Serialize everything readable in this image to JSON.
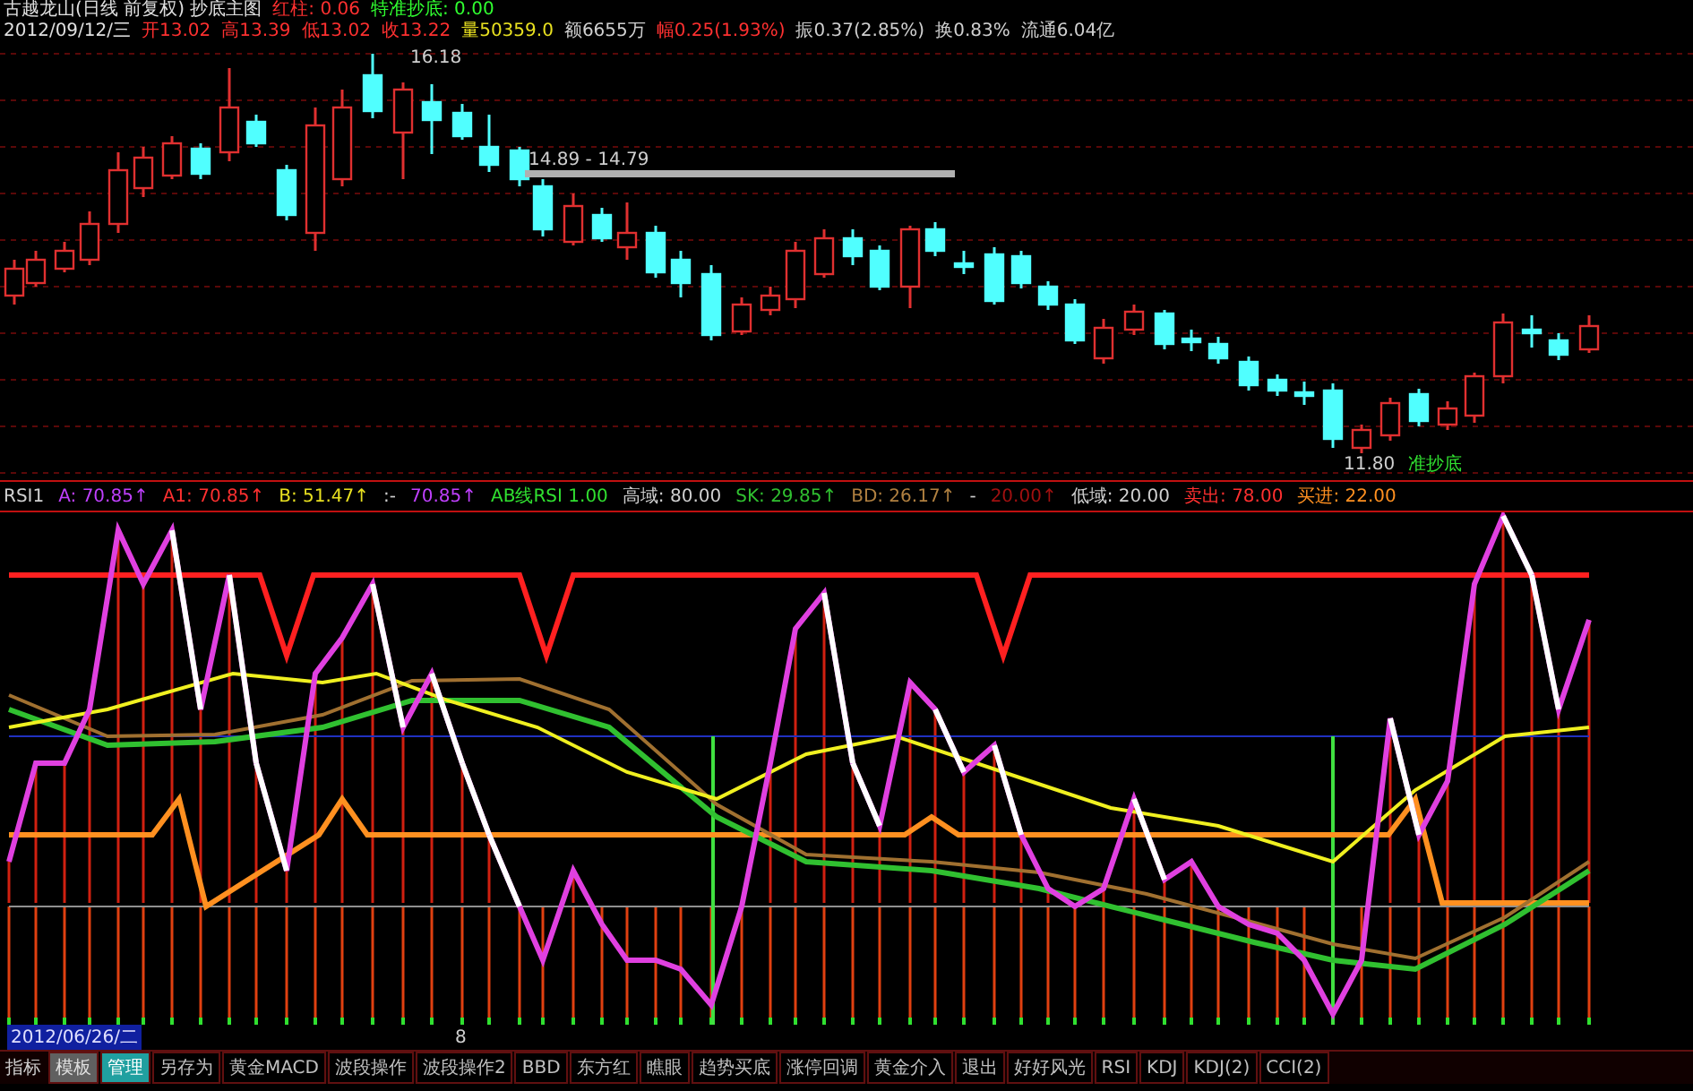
{
  "header": {
    "title": "古越龙山(日线 前复权) 抄底主图",
    "indicators": [
      {
        "label": "红柱:",
        "value": "0.06",
        "color": "#ff3030"
      },
      {
        "label": "特准抄底:",
        "value": "0.00",
        "color": "#30ff30"
      }
    ]
  },
  "quote": {
    "date": "2012/09/12/三",
    "fields": [
      {
        "label": "开",
        "value": "13.02",
        "color": "#ff3030"
      },
      {
        "label": "高",
        "value": "13.39",
        "color": "#ff3030"
      },
      {
        "label": "低",
        "value": "13.02",
        "color": "#ff3030"
      },
      {
        "label": "收",
        "value": "13.22",
        "color": "#ff3030"
      },
      {
        "label": "量",
        "value": "50359.0",
        "color": "#e8e020"
      },
      {
        "label": "额",
        "value": "6655万",
        "color": "#d0d0d0"
      },
      {
        "label": "幅",
        "value": "0.25(1.93%)",
        "color": "#ff3030"
      },
      {
        "label": "振",
        "value": "0.37(2.85%)",
        "color": "#d0d0d0"
      },
      {
        "label": "换",
        "value": "0.83%",
        "color": "#d0d0d0"
      },
      {
        "label": "流通",
        "value": "6.04亿",
        "color": "#d0d0d0"
      }
    ]
  },
  "price_labels": {
    "high": "16.18",
    "range": "14.89 - 14.79",
    "low": "11.80",
    "low_note": "准抄底"
  },
  "rsi_header": [
    {
      "text": "RSI1",
      "color": "#d0d0d0"
    },
    {
      "text": "A: 70.85↑",
      "color": "#c040ff"
    },
    {
      "text": "A1: 70.85↑",
      "color": "#ff3030"
    },
    {
      "text": "B: 51.47↑",
      "color": "#e8e020"
    },
    {
      "text": ":-",
      "color": "#d0d0d0"
    },
    {
      "text": "70.85↑",
      "color": "#c040ff"
    },
    {
      "text": "AB线RSI 1.00",
      "color": "#30e030"
    },
    {
      "text": "高域: 80.00",
      "color": "#d0d0d0"
    },
    {
      "text": "SK: 29.85↑",
      "color": "#30c030"
    },
    {
      "text": "BD: 26.17↑",
      "color": "#b08040"
    },
    {
      "text": "-",
      "color": "#d0d0d0"
    },
    {
      "text": "20.00↑",
      "color": "#a01010"
    },
    {
      "text": "低域: 20.00",
      "color": "#d0d0d0"
    },
    {
      "text": "卖出: 78.00",
      "color": "#ff3030"
    },
    {
      "text": "买进: 22.00",
      "color": "#ff9020"
    }
  ],
  "date_label": "2012/06/26/二",
  "cursor_label": "8",
  "tabs": [
    {
      "label": "指标",
      "kind": "label"
    },
    {
      "label": "模板",
      "kind": "button",
      "selected": false,
      "highlighted": true
    },
    {
      "label": "管理",
      "kind": "button",
      "selected": true,
      "highlighted": false
    },
    {
      "label": "另存为",
      "kind": "button",
      "selected": false,
      "highlighted": false
    },
    {
      "label": "黄金MACD",
      "kind": "button",
      "selected": false,
      "highlighted": false
    },
    {
      "label": "波段操作",
      "kind": "button",
      "selected": false,
      "highlighted": false
    },
    {
      "label": "波段操作2",
      "kind": "button",
      "selected": false,
      "highlighted": false
    },
    {
      "label": "BBD",
      "kind": "button",
      "selected": false,
      "highlighted": false
    },
    {
      "label": "东方红",
      "kind": "button",
      "selected": false,
      "highlighted": false
    },
    {
      "label": "瞧眼",
      "kind": "button",
      "selected": false,
      "highlighted": false
    },
    {
      "label": "趋势买底",
      "kind": "button",
      "selected": false,
      "highlighted": false
    },
    {
      "label": "涨停回调",
      "kind": "button",
      "selected": false,
      "highlighted": false
    },
    {
      "label": "黄金介入",
      "kind": "button",
      "selected": false,
      "highlighted": false
    },
    {
      "label": "退出",
      "kind": "button",
      "selected": false,
      "highlighted": false
    },
    {
      "label": "好好风光",
      "kind": "button",
      "selected": false,
      "highlighted": false
    },
    {
      "label": "RSI",
      "kind": "button",
      "selected": false,
      "highlighted": false
    },
    {
      "label": "KDJ",
      "kind": "button",
      "selected": false,
      "highlighted": false
    },
    {
      "label": "KDJ(2)",
      "kind": "button",
      "selected": false,
      "highlighted": false
    },
    {
      "label": "CCI(2)",
      "kind": "button",
      "selected": false,
      "highlighted": false
    }
  ]
}
